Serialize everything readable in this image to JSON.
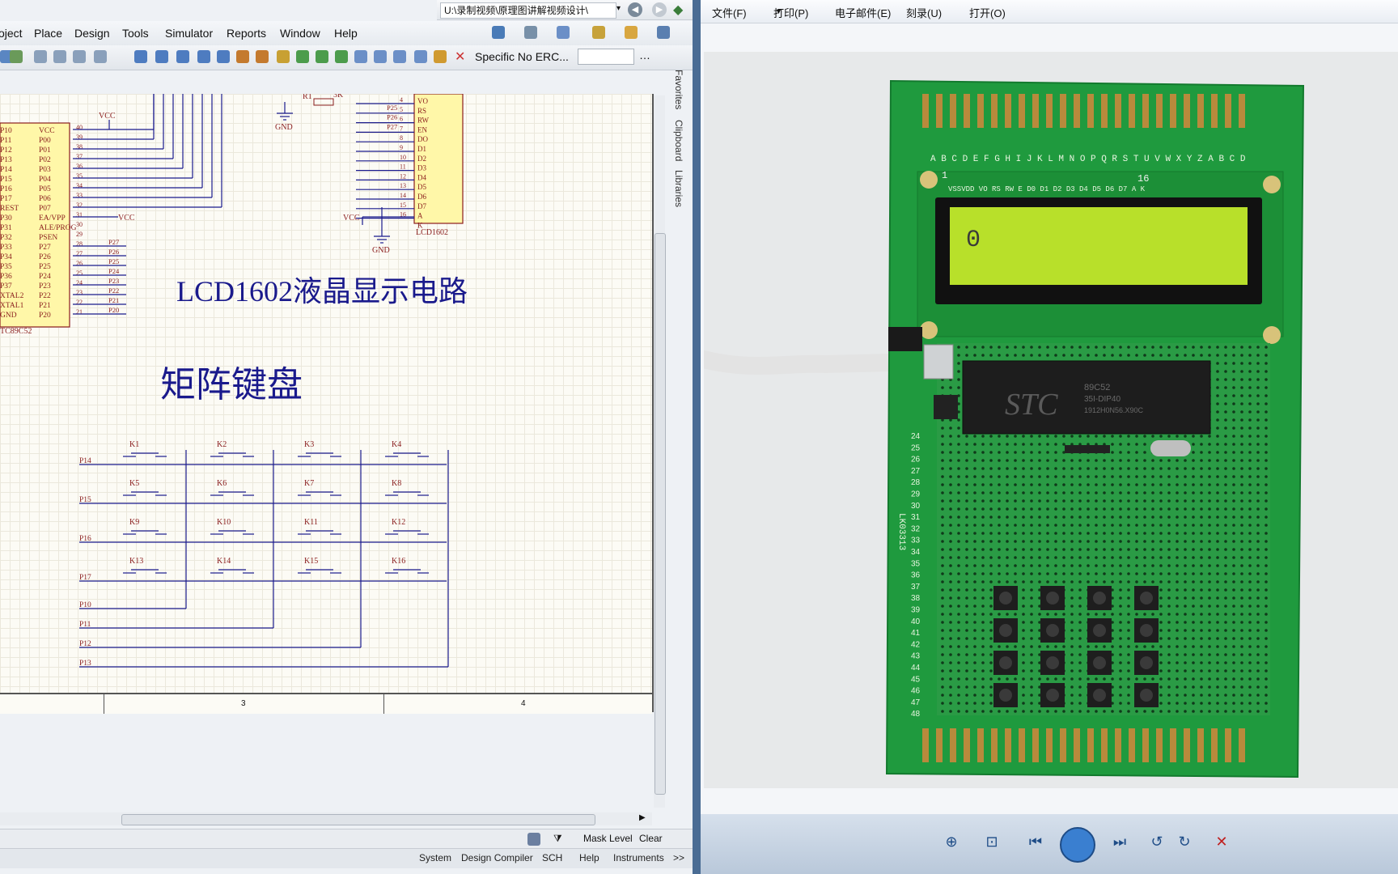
{
  "schematic_app": {
    "path_text": "U:\\录制视频\\原理图讲解视频设计\\",
    "menu": [
      "oject",
      "Place",
      "Design",
      "Tools",
      "Simulator",
      "Reports",
      "Window",
      "Help"
    ],
    "erc_label": "Specific No ERC...",
    "side_tabs": [
      "Favorites",
      "Clipboard",
      "Libraries"
    ],
    "status": {
      "mask_level": "Mask Level",
      "clear": "Clear"
    },
    "bottom_tabs": [
      "System",
      "Design Compiler",
      "SCH",
      "Help",
      "Instruments"
    ],
    "bottom_more": ">>"
  },
  "schematic": {
    "title_lcd": "LCD1602液晶显示电路",
    "title_keypad": "矩阵键盘",
    "mcu_name": "TC89C52",
    "mcu_left_pins": [
      "P10",
      "P11",
      "P12",
      "P13",
      "P14",
      "P15",
      "P16",
      "P17",
      "REST",
      "P30",
      "P31",
      "P32",
      "P33",
      "P34",
      "P35",
      "P36",
      "P37",
      "XTAL2",
      "XTAL1",
      "GND"
    ],
    "mcu_right_pins": [
      "VCC",
      "P00",
      "P01",
      "P02",
      "P03",
      "P04",
      "P05",
      "P06",
      "P07",
      "EA/VPP",
      "ALE/PROG",
      "PSEN",
      "P27",
      "P26",
      "P25",
      "P24",
      "P23",
      "P22",
      "P21",
      "P20"
    ],
    "mcu_right_nums": [
      "40",
      "39",
      "38",
      "37",
      "36",
      "35",
      "34",
      "33",
      "32",
      "31",
      "30",
      "29",
      "28",
      "27",
      "26",
      "25",
      "24",
      "23",
      "22",
      "21"
    ],
    "mcu_net_labels": [
      "P27",
      "P26",
      "P25",
      "P24",
      "P23",
      "P22",
      "P21",
      "P20"
    ],
    "lcd_name": "LCD1602",
    "lcd_pins": [
      "VO",
      "RS",
      "RW",
      "EN",
      "DO",
      "D1",
      "D2",
      "D3",
      "D4",
      "D5",
      "D6",
      "D7",
      "A",
      "K"
    ],
    "lcd_nums": [
      "4",
      "5",
      "6",
      "7",
      "8",
      "9",
      "10",
      "11",
      "12",
      "13",
      "14",
      "15",
      "16"
    ],
    "lcd_nets": [
      "P25",
      "P26",
      "P27"
    ],
    "r1_label": "R1",
    "r1_value": "3K",
    "vcc": "VCC",
    "gnd": "GND",
    "keys": [
      "K1",
      "K2",
      "K3",
      "K4",
      "K5",
      "K6",
      "K7",
      "K8",
      "K9",
      "K10",
      "K11",
      "K12",
      "K13",
      "K14",
      "K15",
      "K16"
    ],
    "row_nets": [
      "P14",
      "P15",
      "P16",
      "P17"
    ],
    "col_nets": [
      "P10",
      "P11",
      "P12",
      "P13"
    ],
    "frame_numbers": [
      "3",
      "4"
    ]
  },
  "viewer_app": {
    "menu": [
      "文件(F)",
      "打印(P)",
      "电子邮件(E)",
      "刻录(U)",
      "打开(O)"
    ]
  },
  "photo": {
    "board_letters": "A B C D E F G H I J K L M N O P Q R S T U V W X Y Z A B C D",
    "lcd_pin_labels": "VSSVDD VO RS RW E  D0 D1 D2 D3 D4 D5 D6 D7  A   K",
    "lcd_display": "0",
    "lcd_pin_first": "1",
    "lcd_pin_last": "16",
    "chip_brand": "STC",
    "chip_model": "89C52",
    "chip_line2": "35I-DIP40",
    "chip_line3": "1912H0N56.X90C",
    "board_code": "LK03313",
    "row_numbers": [
      "24",
      "25",
      "26",
      "27",
      "28",
      "29",
      "30",
      "31",
      "32",
      "33",
      "34",
      "35",
      "36",
      "37",
      "38",
      "39",
      "40",
      "41",
      "42",
      "43",
      "44",
      "45",
      "46",
      "47",
      "48"
    ]
  },
  "colors": {
    "pcb": "#1f9a3e",
    "lcd_screen": "#b8e02a",
    "wire": "#1a1a8c"
  }
}
